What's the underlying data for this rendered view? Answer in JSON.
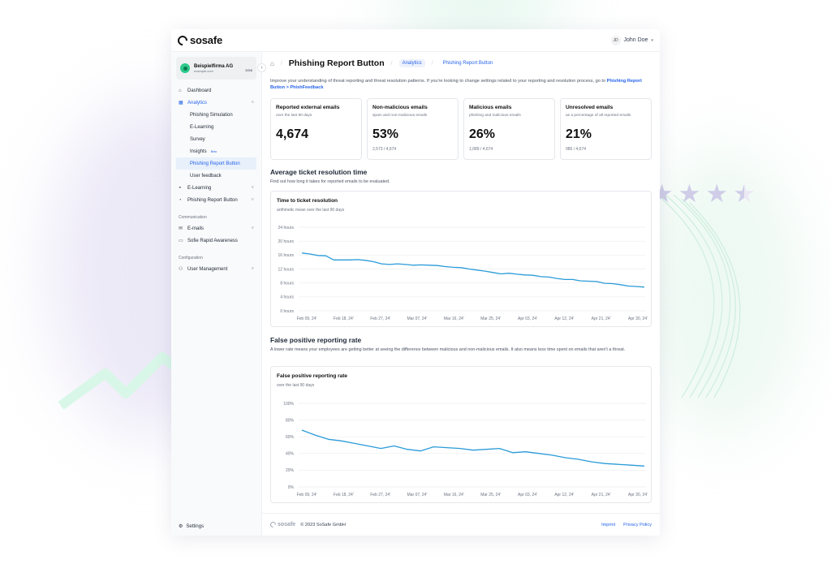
{
  "app": {
    "logo_text": "sosafe",
    "user_initials": "JD",
    "user_name": "John Doe"
  },
  "org": {
    "name": "Beispielfirma AG",
    "domain": "example.com",
    "count": "3458"
  },
  "sidebar": {
    "items": [
      {
        "label": "Dashboard",
        "icon": "home-icon"
      },
      {
        "label": "Analytics",
        "icon": "chart-icon"
      },
      {
        "label": "Phishing Simulation"
      },
      {
        "label": "E-Learning"
      },
      {
        "label": "Survey"
      },
      {
        "label": "Insights",
        "badge": "Beta"
      },
      {
        "label": "Phishing Report Button"
      },
      {
        "label": "User feedback"
      },
      {
        "label": "E-Learning",
        "icon": "graduation-icon"
      },
      {
        "label": "Phishing Report Button",
        "icon": "report-icon"
      }
    ],
    "communication_label": "Communication",
    "communication": [
      {
        "label": "E-mails",
        "icon": "mail-icon"
      },
      {
        "label": "Sofie Rapid Awareness",
        "icon": "chat-icon"
      }
    ],
    "configuration_label": "Configuration",
    "configuration": [
      {
        "label": "User Management",
        "icon": "users-icon"
      }
    ],
    "settings_label": "Settings"
  },
  "page": {
    "title": "Phishing Report Button",
    "breadcrumb": [
      "Analytics",
      "Phishing Report Button"
    ],
    "intro": "Improve your understanding of threat reporting and threat resolution patterns. If you're looking to change settings related to your reporting and resolution process, go to",
    "intro_link": "Phishing Report Button > PhishFeedback"
  },
  "cards": [
    {
      "title": "Reported external emails",
      "subtitle": "over the last 90 days",
      "value": "4,674",
      "footer": ""
    },
    {
      "title": "Non-malicious emails",
      "subtitle": "spam and non-malicious emails",
      "value": "53%",
      "footer": "2,573 / 4,674"
    },
    {
      "title": "Malicious emails",
      "subtitle": "phishing and malicious emails",
      "value": "26%",
      "footer": "1,089 / 4,674"
    },
    {
      "title": "Unresolved emails",
      "subtitle": "as a percentage of all reported emails",
      "value": "21%",
      "footer": "985 / 4,674"
    }
  ],
  "section1": {
    "title": "Average ticket resolution time",
    "desc": "Find out how long it takes for reported emails to be evaluated."
  },
  "section2": {
    "title": "False positive reporting rate",
    "desc": "A lower rate means your employees are getting better at seeing the difference between malicious and non-malicious emails. It also means less time spent on emails that aren't a threat."
  },
  "chart_data": [
    {
      "type": "line",
      "title": "Time to ticket resolution",
      "subtitle": "arithmetic mean over the last 90 days",
      "color": "#2a9bd8",
      "yticks": [
        "0 hours",
        "4 hours",
        "8 hours",
        "12 hours",
        "16 hours",
        "20 hours",
        "24 hours"
      ],
      "ylim": [
        0,
        24
      ],
      "xticks": [
        "Feb 09, 24'",
        "Feb 18, 24'",
        "Feb 27, 24'",
        "Mar 07, 24'",
        "Mar 16, 24'",
        "Mar 25, 24'",
        "Apr 03, 24'",
        "Apr 12, 24'",
        "Apr 21, 24'",
        "Apr 30, 24'"
      ],
      "values": [
        16.6,
        16.3,
        15.9,
        15.8,
        14.6,
        14.6,
        14.6,
        14.7,
        14.5,
        14.1,
        13.5,
        13.3,
        13.5,
        13.3,
        13.1,
        13.2,
        13.1,
        13.0,
        12.7,
        12.5,
        12.4,
        12.0,
        11.7,
        11.4,
        11.0,
        10.6,
        10.8,
        10.5,
        10.3,
        10.2,
        9.8,
        9.7,
        9.3,
        9.0,
        9.0,
        8.6,
        8.5,
        8.4,
        7.9,
        7.8,
        7.5,
        7.1,
        7.0,
        6.8
      ]
    },
    {
      "type": "line",
      "title": "False positive reporting rate",
      "subtitle": "over the last 90 days",
      "color": "#2a9bd8",
      "yticks": [
        "0%",
        "20%",
        "40%",
        "60%",
        "80%",
        "100%"
      ],
      "ylim": [
        0,
        100
      ],
      "xticks": [
        "Feb 09, 24'",
        "Feb 18, 24'",
        "Feb 27, 24'",
        "Mar 07, 24'",
        "Mar 16, 24'",
        "Mar 25, 24'",
        "Apr 03, 24'",
        "Apr 12, 24'",
        "Apr 21, 24'",
        "Apr 30, 24'"
      ],
      "values": [
        68,
        62,
        57,
        55,
        52,
        49,
        46,
        49,
        45,
        43,
        48,
        47,
        46,
        44,
        45,
        46,
        41,
        42,
        40,
        38,
        35,
        33,
        30,
        28,
        27,
        26,
        25
      ]
    }
  ],
  "footer": {
    "copyright": "© 2023 SoSafe GmbH",
    "imprint": "Imprint",
    "privacy": "Privacy Policy"
  }
}
